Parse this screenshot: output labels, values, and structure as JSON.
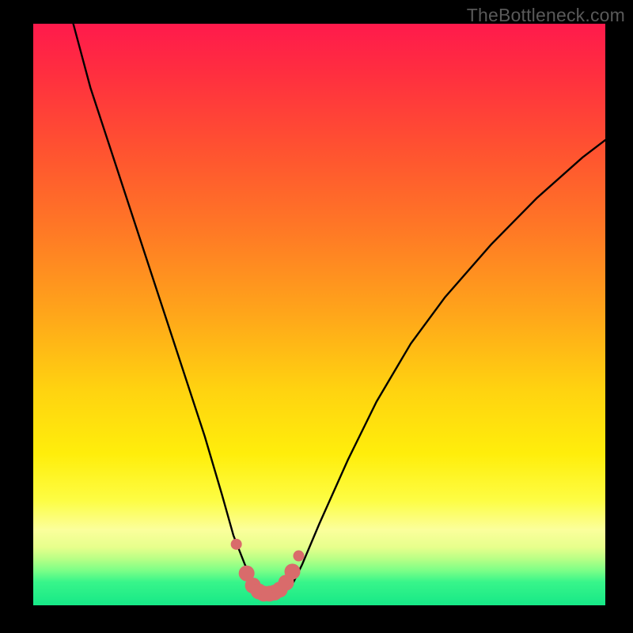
{
  "watermark": "TheBottleneck.com",
  "chart_data": {
    "type": "line",
    "title": "",
    "xlabel": "",
    "ylabel": "",
    "xlim": [
      0,
      100
    ],
    "ylim": [
      0,
      100
    ],
    "series": [
      {
        "name": "bottleneck-curve",
        "x": [
          7,
          10,
          14,
          18,
          22,
          26,
          30,
          33,
          35,
          37,
          38.5,
          39.5,
          40.5,
          42,
          44,
          45.5,
          47,
          50,
          55,
          60,
          66,
          72,
          80,
          88,
          96,
          100
        ],
        "y": [
          100,
          89,
          77,
          65,
          53,
          41,
          29,
          19,
          12,
          7,
          4,
          2.5,
          2,
          2,
          2.5,
          4,
          7,
          14,
          25,
          35,
          45,
          53,
          62,
          70,
          77,
          80
        ]
      },
      {
        "name": "optimal-markers",
        "x": [
          35.5,
          37.3,
          38.4,
          39.4,
          40.3,
          41.3,
          42.2,
          43.1,
          44.2,
          45.3,
          46.4
        ],
        "y": [
          10.5,
          5.5,
          3.4,
          2.4,
          2.0,
          2.0,
          2.2,
          2.7,
          3.9,
          5.8,
          8.5
        ]
      }
    ],
    "colors": {
      "curve": "#000000",
      "marker": "#d96b6b"
    }
  }
}
